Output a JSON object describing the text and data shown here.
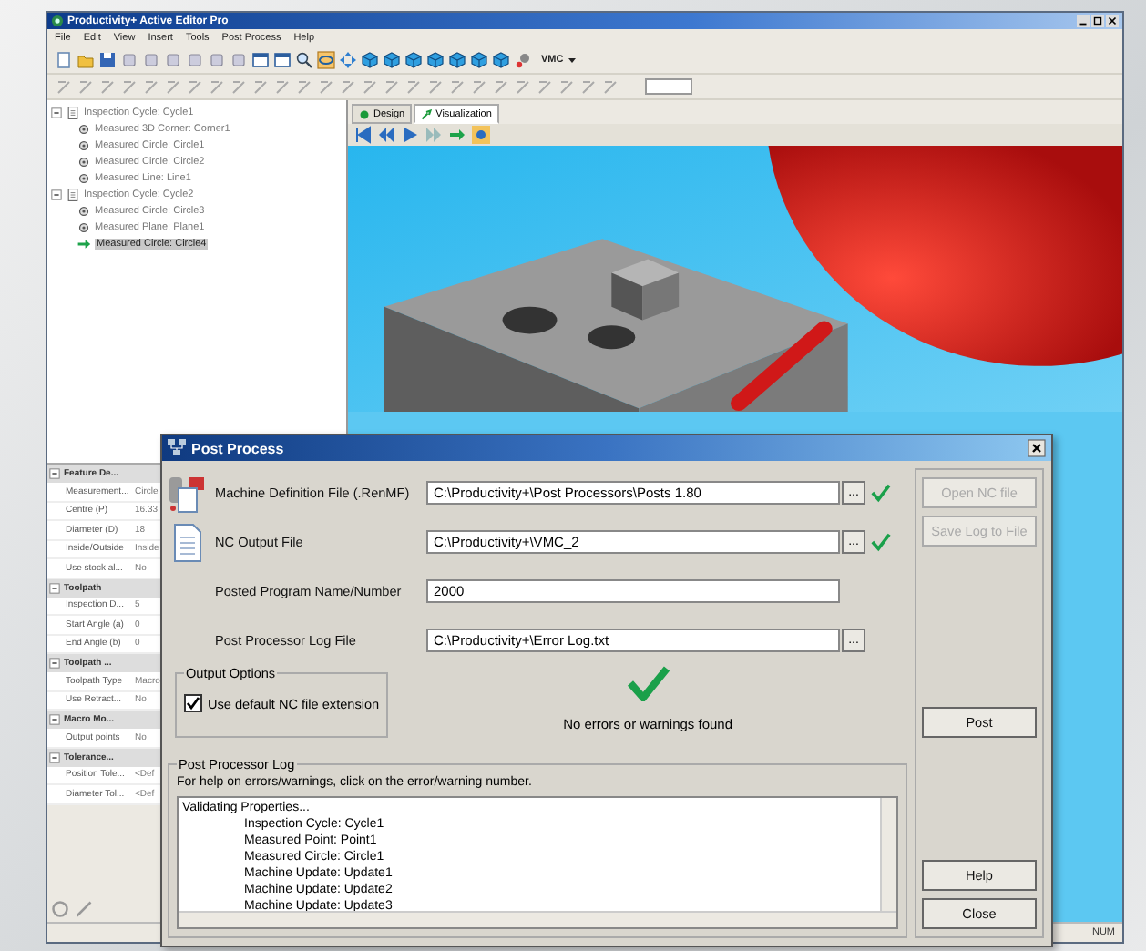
{
  "window": {
    "title": "Productivity+ Active Editor Pro"
  },
  "menu": [
    "File",
    "Edit",
    "View",
    "Insert",
    "Tools",
    "Post Process",
    "Help"
  ],
  "toolbar": {
    "machine": "VMC"
  },
  "tree": [
    {
      "label": "Inspection Cycle: Cycle1",
      "expanded": true,
      "children": [
        {
          "label": "Measured 3D Corner: Corner1",
          "selected": false
        },
        {
          "label": "Measured Circle: Circle1",
          "selected": false
        },
        {
          "label": "Measured Circle: Circle2",
          "selected": false
        },
        {
          "label": "Measured Line: Line1",
          "selected": false
        }
      ]
    },
    {
      "label": "Inspection Cycle: Cycle2",
      "expanded": true,
      "children": [
        {
          "label": "Measured Circle: Circle3",
          "selected": false
        },
        {
          "label": "Measured Plane: Plane1",
          "selected": false
        },
        {
          "label": "Measured Circle: Circle4",
          "selected": true
        }
      ]
    }
  ],
  "properties": [
    {
      "category": "Feature De...",
      "expanded": true,
      "rows": [
        {
          "name": "Measurement...",
          "value": "Circle"
        },
        {
          "name": "Centre (P)",
          "value": "16.33"
        },
        {
          "name": "Diameter (D)",
          "value": "18"
        },
        {
          "name": "Inside/Outside",
          "value": "Inside"
        },
        {
          "name": "Use stock al...",
          "value": "No"
        }
      ]
    },
    {
      "category": "Toolpath",
      "expanded": true,
      "rows": [
        {
          "name": "Inspection D...",
          "value": "5"
        },
        {
          "name": "Start Angle (a)",
          "value": "0"
        },
        {
          "name": "End Angle (b)",
          "value": "0"
        }
      ]
    },
    {
      "category": "Toolpath ...",
      "expanded": true,
      "rows": [
        {
          "name": "Toolpath Type",
          "value": "Macro"
        },
        {
          "name": "Use Retract...",
          "value": "No"
        }
      ]
    },
    {
      "category": "Macro Mo...",
      "expanded": true,
      "rows": [
        {
          "name": "Output points",
          "value": "No"
        }
      ]
    },
    {
      "category": "Tolerance...",
      "expanded": true,
      "rows": [
        {
          "name": "Position Tole...",
          "value": "<Def"
        },
        {
          "name": "Diameter Tol...",
          "value": "<Def"
        }
      ]
    }
  ],
  "view_tabs": [
    {
      "label": "Design",
      "selected": false
    },
    {
      "label": "Visualization",
      "selected": true
    }
  ],
  "status_bar": {
    "indicator": "NUM"
  },
  "dialog": {
    "title": "Post Process",
    "fields": [
      {
        "kind": "machine",
        "label": "Machine Definition File (.RenMF)",
        "value": "C:\\Productivity+\\Post Processors\\Posts 1.80",
        "browse": "...",
        "valid": true
      },
      {
        "kind": "document",
        "label": "NC Output File",
        "value": "C:\\Productivity+\\VMC_2",
        "browse": "...",
        "valid": true
      },
      {
        "kind": "plain",
        "label": "Posted Program Name/Number",
        "value": "2000",
        "valid": false
      },
      {
        "kind": "plain",
        "label": "Post Processor Log File",
        "value": "C:\\Productivity+\\Error Log.txt",
        "browse": "...",
        "valid": false
      }
    ],
    "output_options": {
      "title": "Output Options",
      "checkbox": {
        "label": "Use default NC file extension",
        "checked": true
      }
    },
    "result": {
      "ok": true,
      "message": "No errors or warnings found"
    },
    "log": {
      "title": "Post Processor Log",
      "hint": "For help on errors/warnings, click on the error/warning number.",
      "lines": [
        {
          "text": "Validating Properties...",
          "children": [
            {
              "text": "Inspection Cycle: Cycle1"
            },
            {
              "text": "Measured Point: Point1"
            },
            {
              "text": "Measured Circle: Circle1"
            },
            {
              "text": "Machine Update: Update1"
            },
            {
              "text": "Machine Update: Update2"
            },
            {
              "text": "Machine Update: Update3"
            }
          ]
        }
      ]
    },
    "buttons": [
      {
        "kind": "top",
        "label": "Open NC file",
        "disabled": true
      },
      {
        "kind": "top",
        "label": "Save Log to File",
        "disabled": true
      },
      {
        "kind": "post",
        "label": "Post",
        "disabled": false
      },
      {
        "kind": "bottom",
        "label": "Help",
        "disabled": false
      },
      {
        "kind": "bottom",
        "label": "Close",
        "disabled": false
      }
    ]
  }
}
